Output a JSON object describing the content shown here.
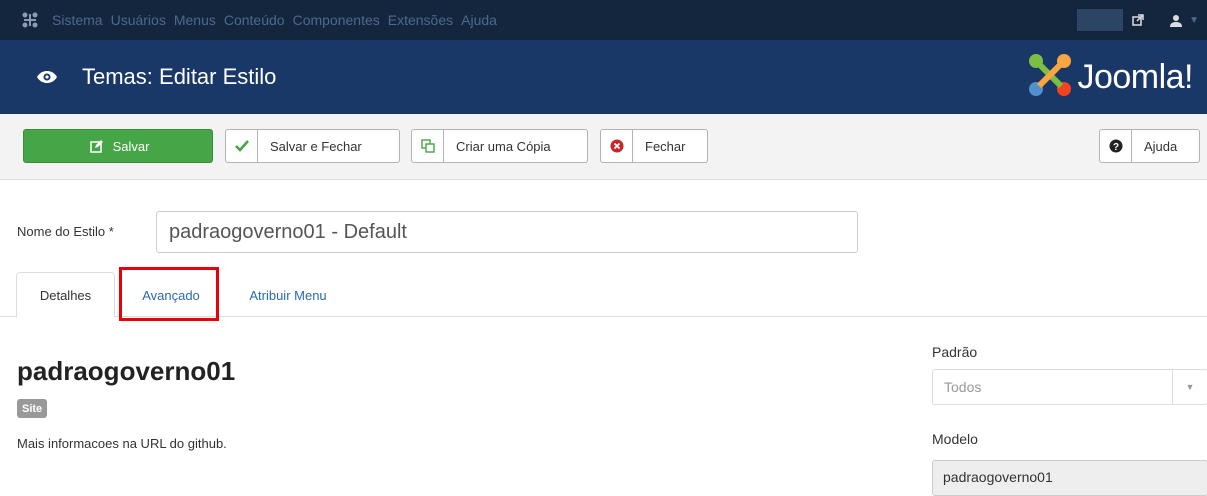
{
  "topnav": {
    "menu": [
      "Sistema",
      "Usuários",
      "Menus",
      "Conteúdo",
      "Componentes",
      "Extensões",
      "Ajuda"
    ],
    "icons": [
      "joomla-logo-icon",
      "external-link-icon",
      "user-icon"
    ]
  },
  "header": {
    "title": "Temas: Editar Estilo",
    "brand": "Joomla!"
  },
  "toolbar": {
    "save_label": "Salvar",
    "save_close_label": "Salvar e Fechar",
    "copy_label": "Criar uma Cópia",
    "close_label": "Fechar",
    "help_label": "Ajuda"
  },
  "form": {
    "name_label": "Nome do Estilo *",
    "name_value": "padraogoverno01 - Default"
  },
  "tabs": [
    "Detalhes",
    "Avançado",
    "Atribuir Menu"
  ],
  "details": {
    "template_name": "padraogoverno01",
    "badge": "Site",
    "description": "Mais informacoes na URL do github."
  },
  "sidebar": {
    "default_label": "Padrão",
    "default_value": "Todos",
    "template_label": "Modelo",
    "template_value": "padraogoverno01"
  },
  "colors": {
    "topnav_bg": "#14263e",
    "header_bg": "#1a3867",
    "save_green": "#46a546",
    "link_blue": "#2a69b8",
    "highlight_red": "#e8000b"
  }
}
